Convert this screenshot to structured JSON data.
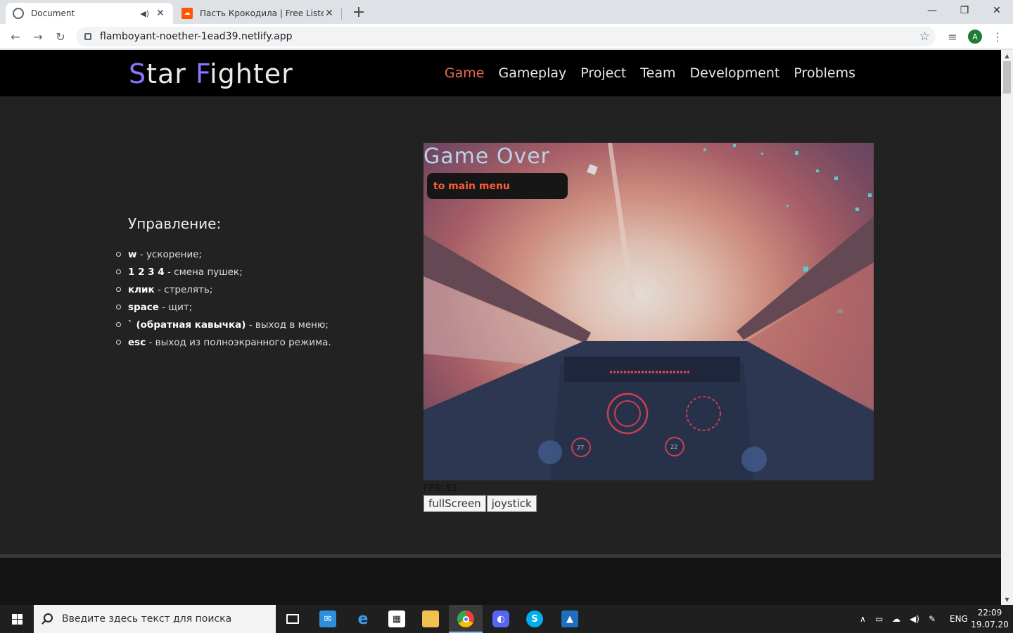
{
  "browser": {
    "tabs": [
      {
        "title": "Document",
        "active": true
      },
      {
        "title": "Пасть Крокодила | Free Listening",
        "active": false
      }
    ],
    "new_tab": "+",
    "window_controls": {
      "minimize": "—",
      "maximize": "❐",
      "close": "✕"
    },
    "url": "flamboyant-noether-1ead39.netlify.app",
    "profile_initial": "A"
  },
  "site": {
    "logo_part1_accent": "S",
    "logo_part1_rest": "tar ",
    "logo_part2_accent": "F",
    "logo_part2_rest": "ighter",
    "nav": [
      "Game",
      "Gameplay",
      "Project",
      "Team",
      "Development",
      "Problems"
    ],
    "nav_current": "Game",
    "accent_color": "#8f73ff",
    "nav_current_color": "#e86a52"
  },
  "controls": {
    "title": "Управление:",
    "items": [
      {
        "key": "w",
        "desc": " - ускорение;"
      },
      {
        "key": "1 2 3 4",
        "desc": " - смена пушек;"
      },
      {
        "key": "клик",
        "desc": " - стрелять;"
      },
      {
        "key": "space",
        "desc": " - щит;"
      },
      {
        "key": "` (обратная кавычка)",
        "desc": " - выход в меню;"
      },
      {
        "key": "esc",
        "desc": " - выход из полноэкранного режима."
      }
    ]
  },
  "game": {
    "overlay_title": "Game Over",
    "menu_button": "to main menu",
    "fps_label": "FPS: 51",
    "hud_left_dial": "27",
    "hud_right_dial": "22",
    "buttons": {
      "fullscreen": "fullScreen",
      "joystick": "joystick"
    }
  },
  "taskbar": {
    "search_placeholder": "Введите здесь текст для поиска",
    "language": "ENG",
    "time": "22:09",
    "date": "19.07.20"
  }
}
